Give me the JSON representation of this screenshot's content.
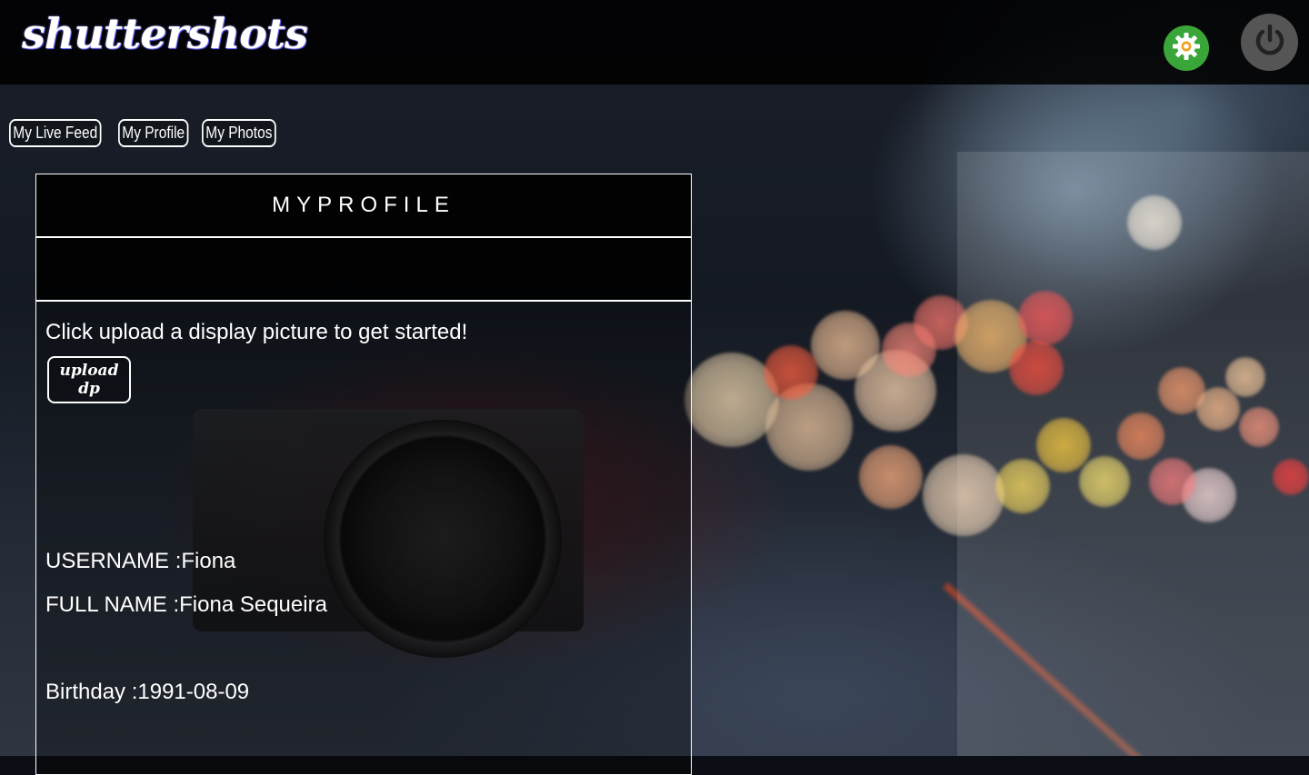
{
  "header": {
    "logo": "shuttershots",
    "settings_icon": "gear-icon",
    "power_icon": "power-icon",
    "settings_color": "#3aa63a",
    "power_color": "#555555"
  },
  "nav": {
    "items": [
      {
        "label": "My Live Feed"
      },
      {
        "label": "My Profile"
      },
      {
        "label": "My Photos"
      }
    ]
  },
  "profile": {
    "title": "MYPROFILE",
    "prompt": "Click upload a display picture to get started!",
    "upload_label": "upload dp",
    "username_label": "USERNAME :",
    "username": "Fiona",
    "fullname_label": "FULL NAME :",
    "fullname": "Fiona Sequeira",
    "birthday_label": "Birthday :",
    "birthday": "1991-08-09"
  }
}
